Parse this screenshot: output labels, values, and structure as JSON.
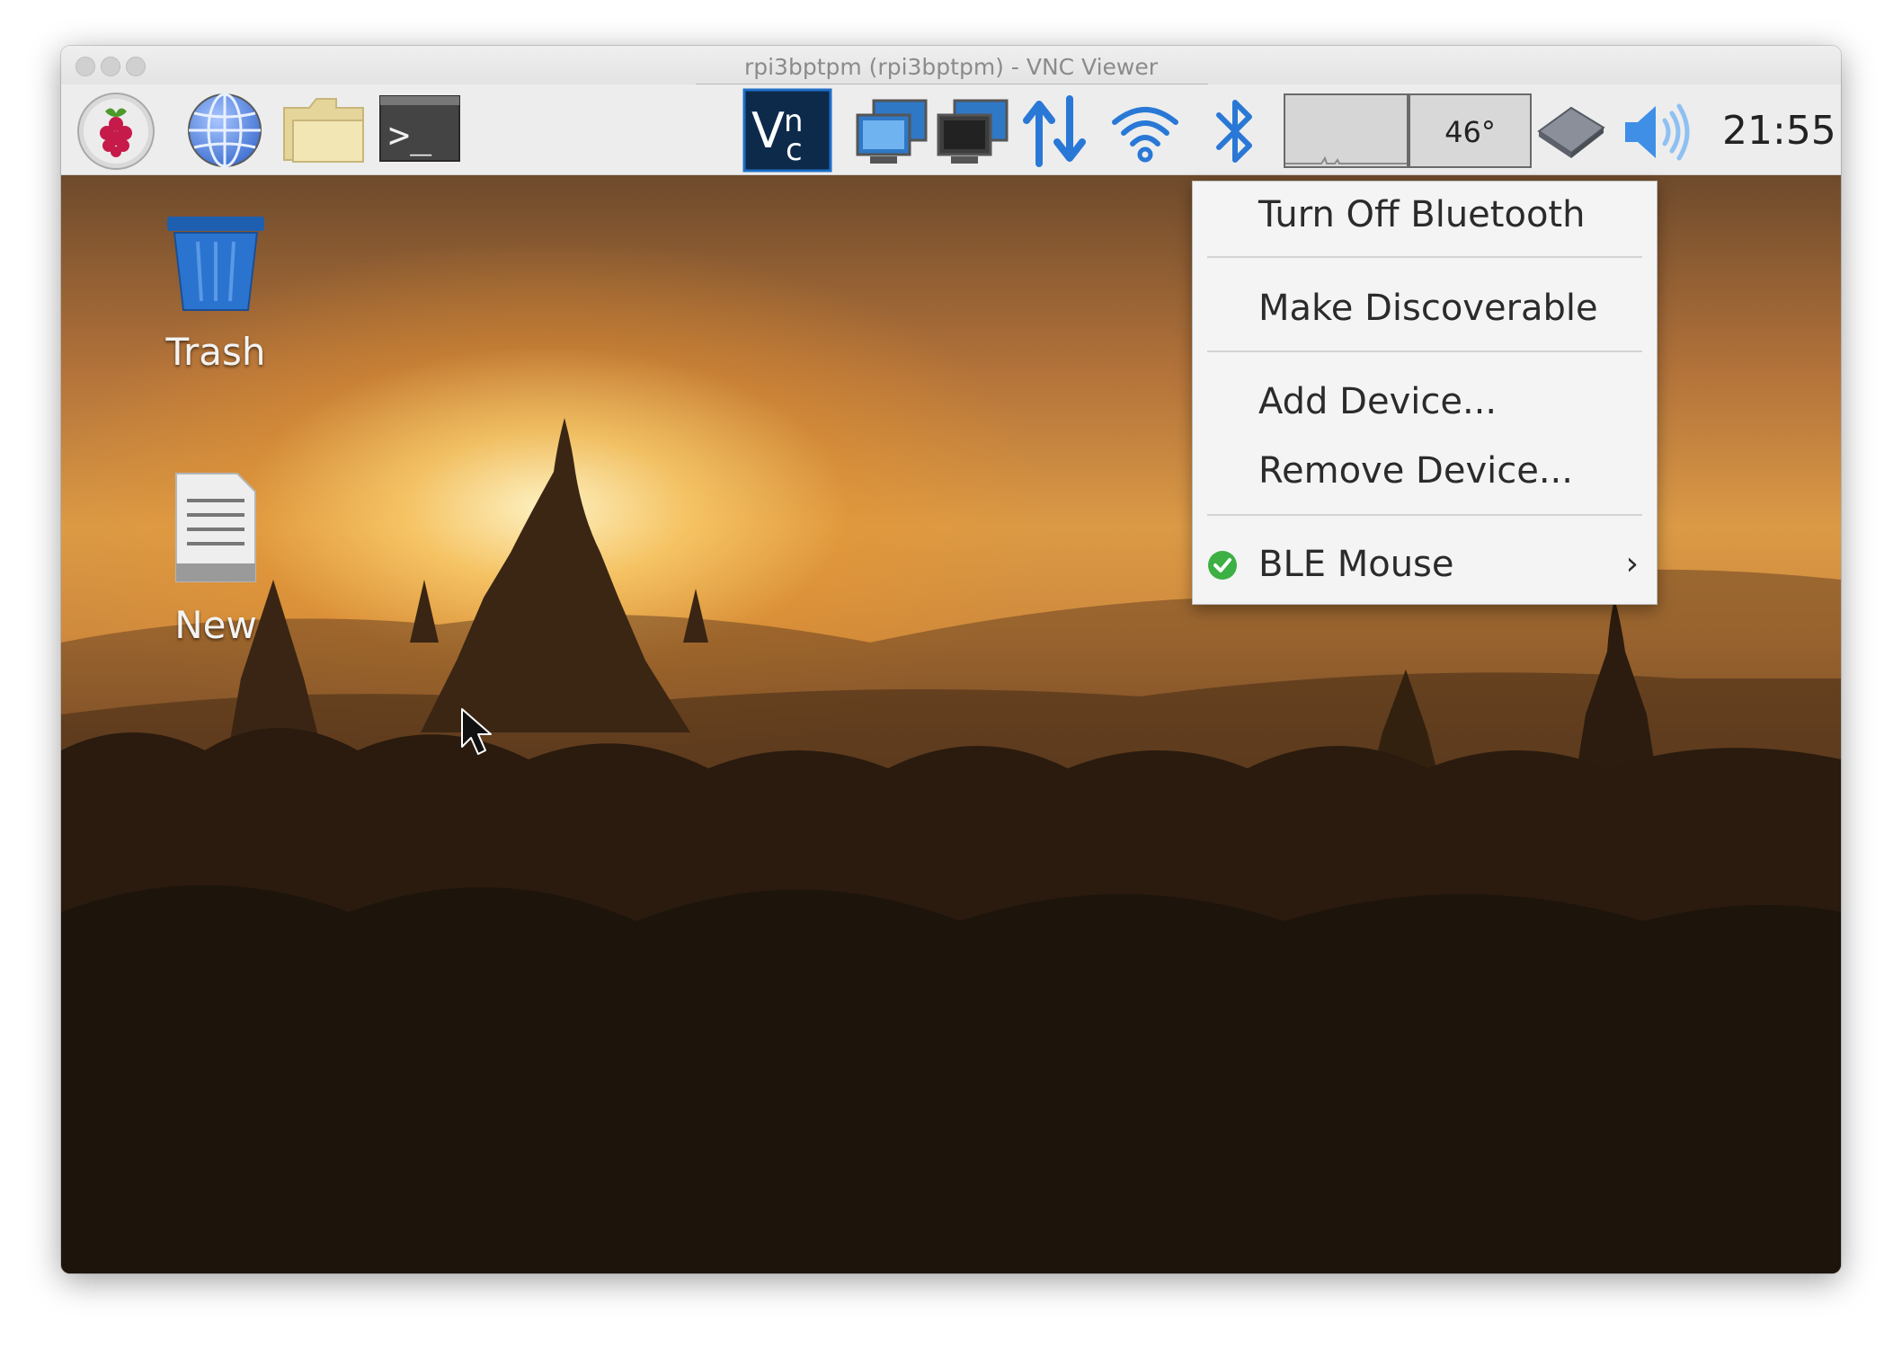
{
  "window": {
    "title": "rpi3bptpm (rpi3bptpm) - VNC Viewer"
  },
  "taskbar": {
    "launchers": [
      {
        "icon": "raspberry-menu-icon"
      },
      {
        "icon": "web-browser-globe-icon"
      },
      {
        "icon": "file-manager-folder-icon"
      },
      {
        "icon": "terminal-icon"
      }
    ],
    "tray": [
      {
        "icon": "vnc-server-icon"
      },
      {
        "icon": "network-computer-icon"
      },
      {
        "icon": "network-computer-icon"
      },
      {
        "icon": "network-updown-arrows-icon"
      },
      {
        "icon": "wifi-icon"
      },
      {
        "icon": "bluetooth-icon"
      },
      {
        "icon": "cpu-usage-graph"
      },
      {
        "icon": "eject-drive-icon"
      },
      {
        "icon": "volume-icon"
      }
    ],
    "temperature": "46°",
    "clock": "21:55"
  },
  "desktop": {
    "icons": [
      {
        "label": "Trash",
        "icon": "trash-icon"
      },
      {
        "label": "New",
        "icon": "text-file-icon"
      }
    ]
  },
  "bluetooth_menu": {
    "items": [
      {
        "label": "Turn Off Bluetooth"
      },
      {
        "label": "Make Discoverable"
      },
      {
        "label": "Add Device..."
      },
      {
        "label": "Remove Device..."
      },
      {
        "label": "BLE Mouse",
        "connected": true,
        "has_submenu": true
      }
    ],
    "submenu_glyph": "›"
  },
  "colors": {
    "bluetooth_blue": "#2a78d6",
    "connected_green": "#3cb043",
    "vnc_navy": "#0d2a4a"
  }
}
